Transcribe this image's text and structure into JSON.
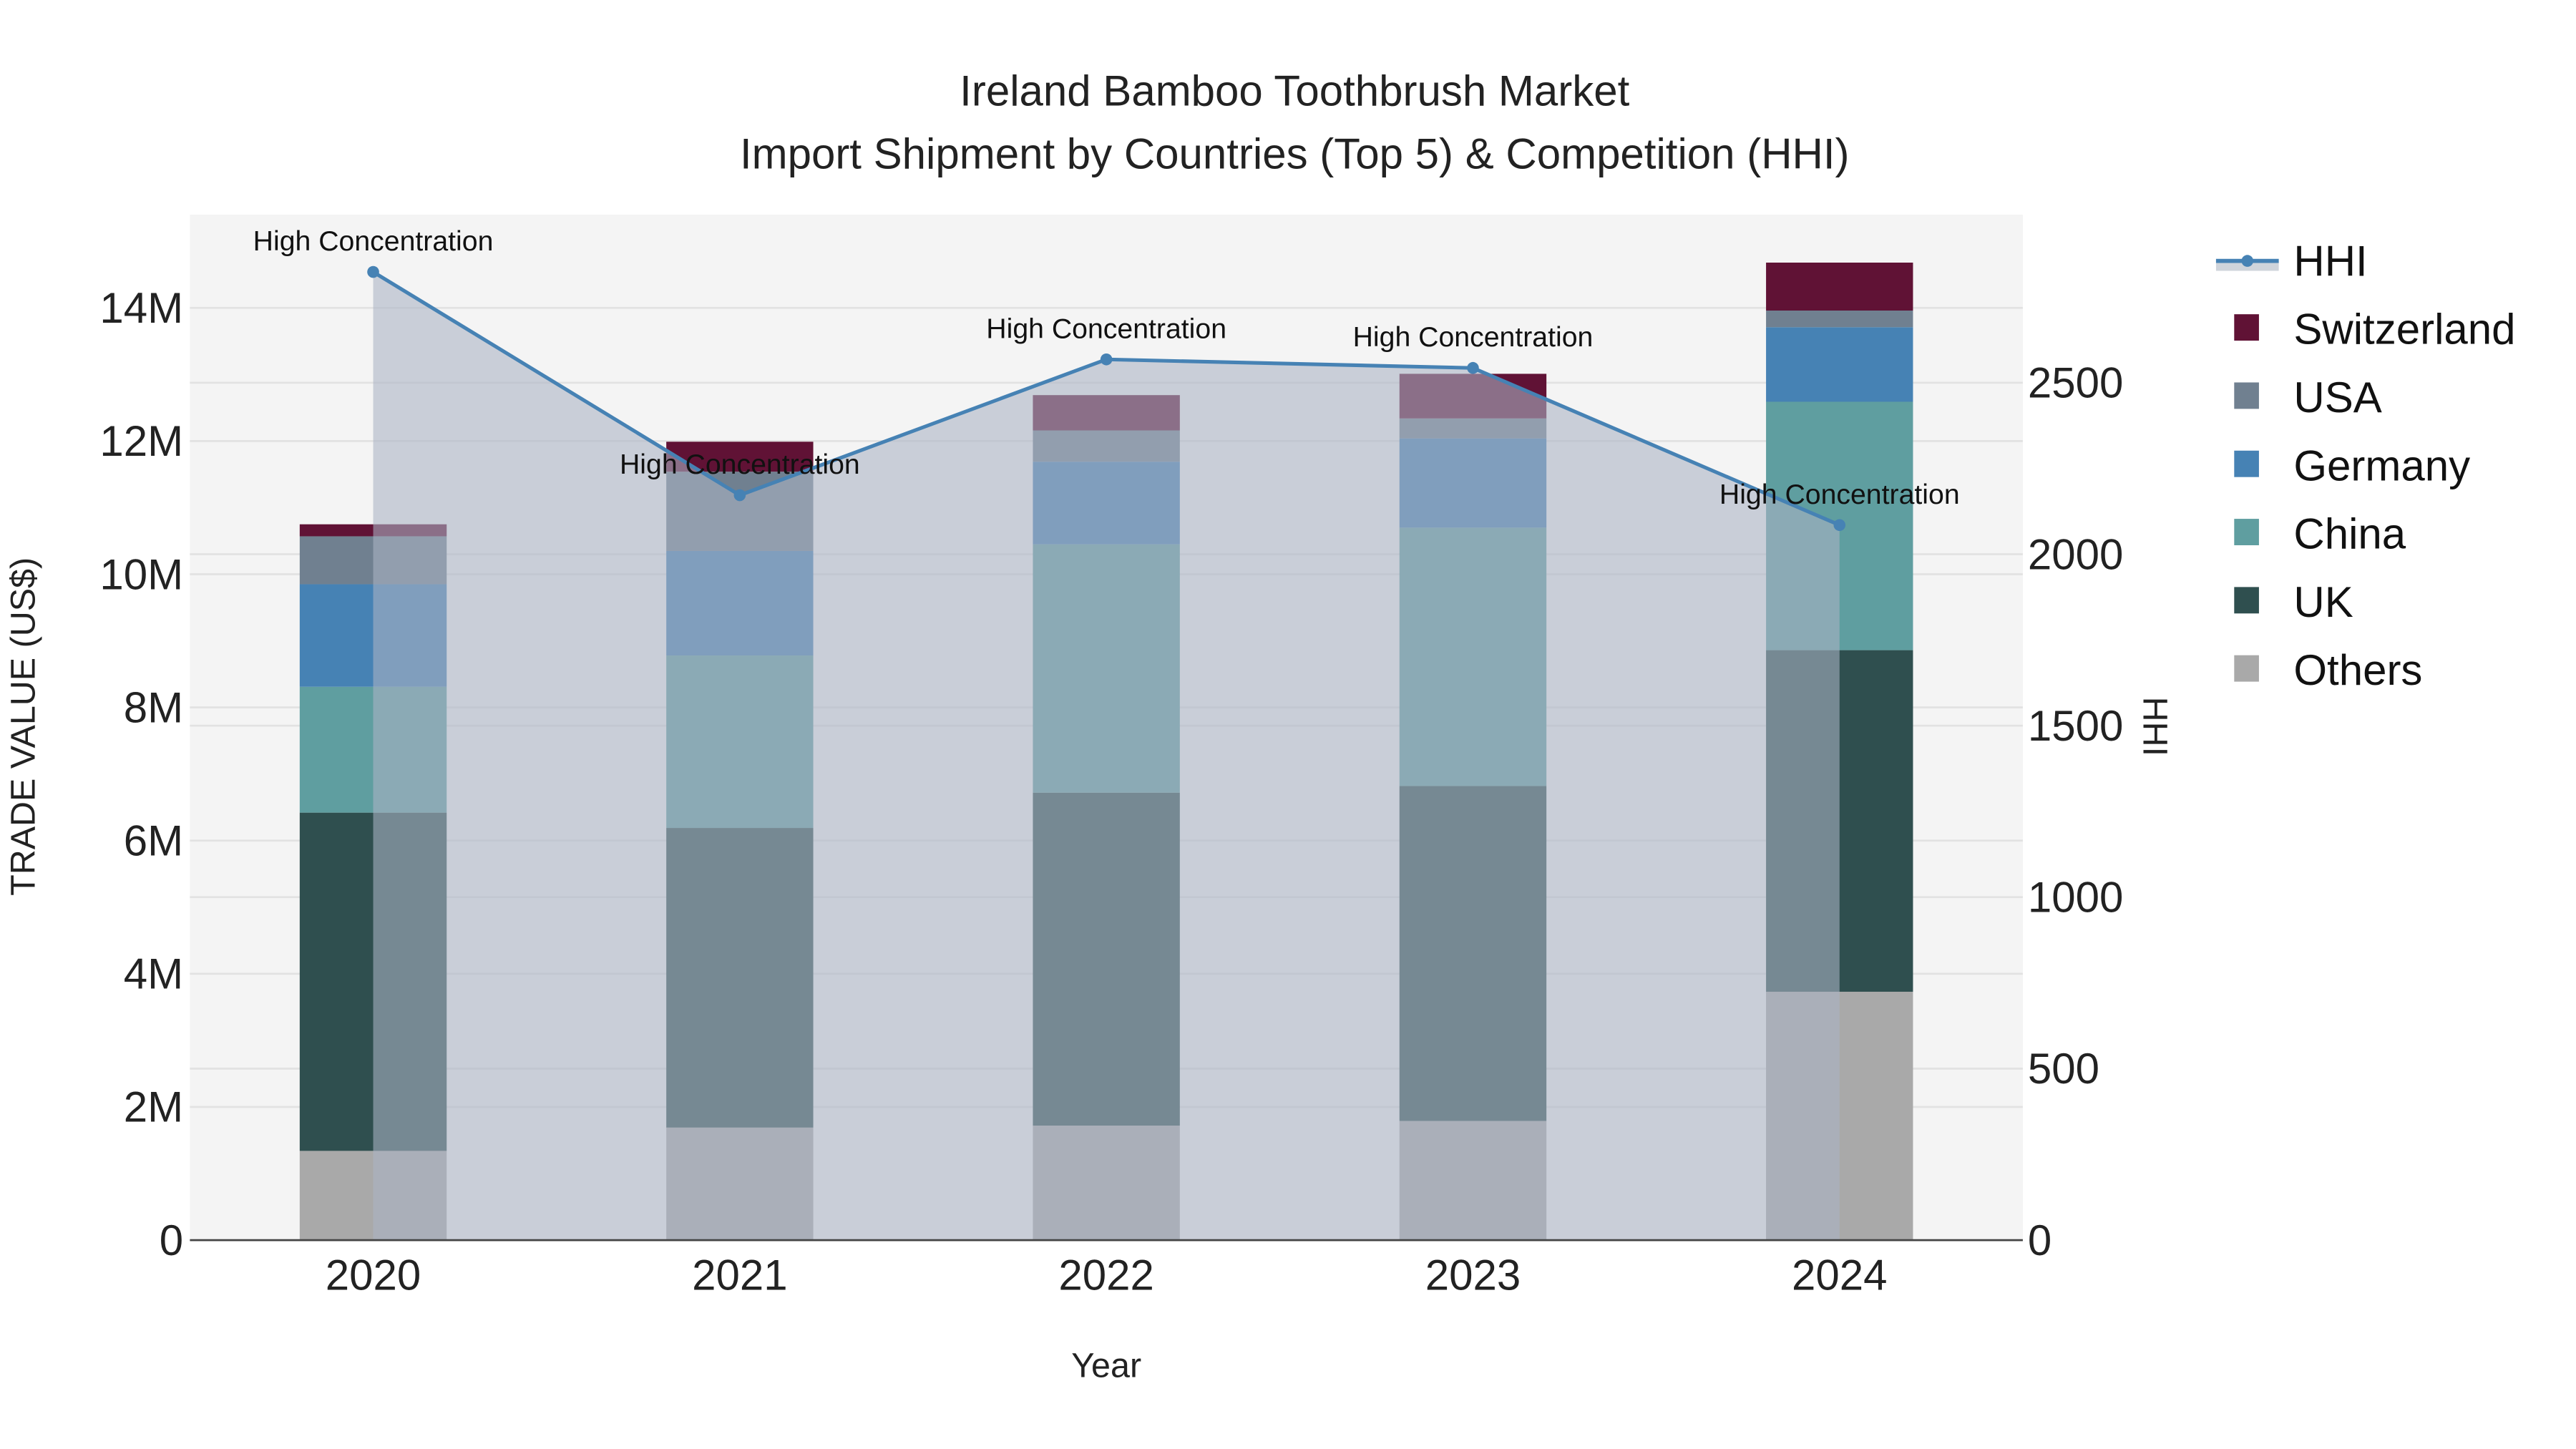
{
  "chart_data": {
    "type": "bar",
    "title": "Ireland Bamboo Toothbrush Market",
    "subtitle": "Import Shipment by Countries (Top 5) & Competition (HHI)",
    "xlabel": "Year",
    "ylabel": "TRADE VALUE (US$)",
    "y2label": "HHI",
    "categories": [
      "2020",
      "2021",
      "2022",
      "2023",
      "2024"
    ],
    "ylim": [
      0,
      15400000
    ],
    "y_ticks": [
      0,
      2000000,
      4000000,
      6000000,
      8000000,
      10000000,
      12000000,
      14000000
    ],
    "y_tick_labels": [
      "0",
      "2M",
      "4M",
      "6M",
      "8M",
      "10M",
      "12M",
      "14M"
    ],
    "y2lim": [
      0,
      2990
    ],
    "y2_ticks": [
      0,
      500,
      1000,
      1500,
      2000,
      2500
    ],
    "y2_tick_labels": [
      "0",
      "500",
      "1000",
      "1500",
      "2000",
      "2500"
    ],
    "stacked": true,
    "series": [
      {
        "name": "Others",
        "color": "#a9a9a9",
        "values": [
          1340000,
          1690000,
          1720000,
          1790000,
          3730000
        ]
      },
      {
        "name": "UK",
        "color": "#2f4f4f",
        "values": [
          5080000,
          4500000,
          5000000,
          5030000,
          5130000
        ]
      },
      {
        "name": "China",
        "color": "#5f9ea0",
        "values": [
          1890000,
          2590000,
          3730000,
          3880000,
          3730000
        ]
      },
      {
        "name": "Germany",
        "color": "#4682b4",
        "values": [
          1540000,
          1570000,
          1240000,
          1340000,
          1120000
        ]
      },
      {
        "name": "USA",
        "color": "#708090",
        "values": [
          720000,
          1190000,
          470000,
          300000,
          250000
        ]
      },
      {
        "name": "Switzerland",
        "color": "#601235",
        "values": [
          180000,
          450000,
          530000,
          670000,
          720000
        ]
      }
    ],
    "hhi": {
      "name": "HHI",
      "color": "#4682b4",
      "values": [
        2823,
        2172,
        2568,
        2543,
        2085
      ]
    },
    "annotations": [
      "High Concentration",
      "High Concentration",
      "High Concentration",
      "High Concentration",
      "High Concentration"
    ],
    "legend_order": [
      "HHI",
      "Switzerland",
      "USA",
      "Germany",
      "China",
      "UK",
      "Others"
    ],
    "legend_position": "right",
    "grid": true
  }
}
